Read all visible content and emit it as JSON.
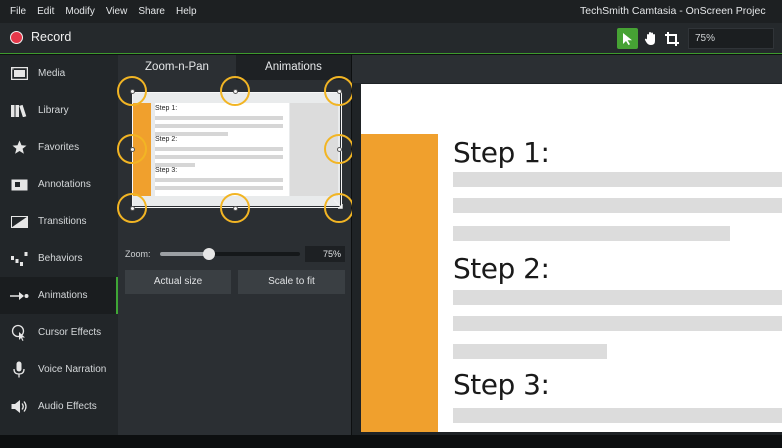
{
  "menubar": {
    "items": [
      "File",
      "Edit",
      "Modify",
      "View",
      "Share",
      "Help"
    ],
    "title": "TechSmith Camtasia - OnScreen Projec"
  },
  "toolbar": {
    "record_label": "Record",
    "zoom_value": "75%",
    "tools": [
      "pointer-icon",
      "hand-icon",
      "crop-icon"
    ]
  },
  "sidebar": {
    "items": [
      {
        "label": "Media",
        "icon": "film-strip-icon"
      },
      {
        "label": "Library",
        "icon": "books-icon"
      },
      {
        "label": "Favorites",
        "icon": "star-icon"
      },
      {
        "label": "Annotations",
        "icon": "callout-icon"
      },
      {
        "label": "Transitions",
        "icon": "transition-icon"
      },
      {
        "label": "Behaviors",
        "icon": "behaviors-icon"
      },
      {
        "label": "Animations",
        "icon": "animation-arrow-icon"
      },
      {
        "label": "Cursor Effects",
        "icon": "cursor-effect-icon"
      },
      {
        "label": "Voice Narration",
        "icon": "microphone-icon"
      },
      {
        "label": "Audio Effects",
        "icon": "speaker-icon"
      }
    ],
    "active": "Animations"
  },
  "panel": {
    "tabs": [
      "Zoom-n-Pan",
      "Animations"
    ],
    "active_tab": "Zoom-n-Pan",
    "thumb_steps": [
      "Step 1:",
      "Step 2:",
      "Step 3:"
    ],
    "actual_size_label": "Actual size",
    "scale_to_fit_label": "Scale to fit",
    "zoom_label": "Zoom:",
    "zoom_value": "75%",
    "zoom_fraction": 0.35,
    "accent_color": "#f2b524"
  },
  "canvas": {
    "steps": [
      "Step 1:",
      "Step 2:",
      "Step 3:"
    ],
    "stripe_color": "#f0a02d"
  }
}
